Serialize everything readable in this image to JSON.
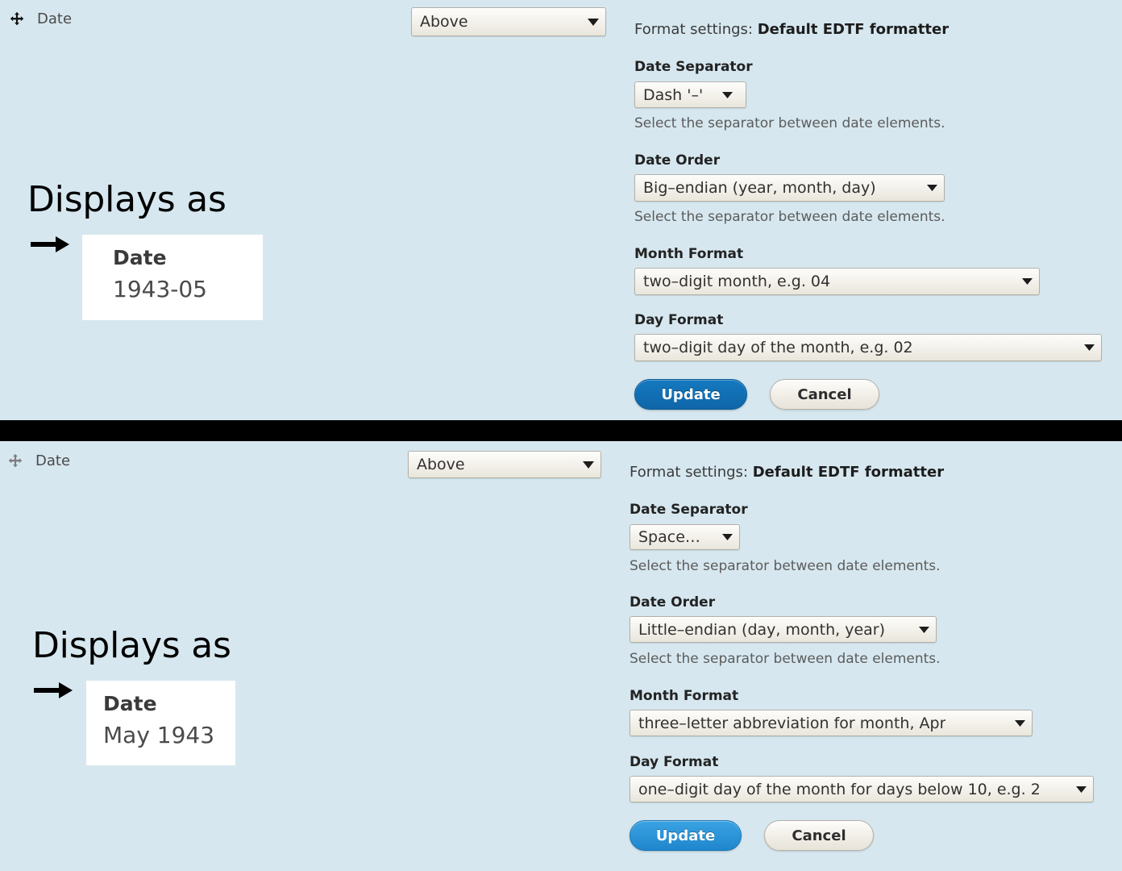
{
  "background_color": "#d6e7ef",
  "panels": [
    {
      "id": "top",
      "field": {
        "drag_handle_icon": "move-arrows-icon",
        "label": "Date",
        "label_display_select": {
          "value": "Above",
          "caret_icon": "chevron-down-icon"
        }
      },
      "preview": {
        "caption": "Displays as",
        "arrow_icon": "right-arrow-icon",
        "card_label": "Date",
        "card_value": "1943-05"
      },
      "settings": {
        "title_prefix": "Format settings:",
        "title_name": "Default EDTF formatter",
        "fields": [
          {
            "label": "Date Separator",
            "value": "Dash '–'",
            "description": "Select the separator between date elements."
          },
          {
            "label": "Date Order",
            "value": "Big–endian (year, month, day)",
            "description": "Select the separator between date elements."
          },
          {
            "label": "Month Format",
            "value": "two–digit month, e.g. 04",
            "description": ""
          },
          {
            "label": "Day Format",
            "value": "two–digit day of the month, e.g. 02",
            "description": ""
          }
        ],
        "update_label": "Update",
        "cancel_label": "Cancel",
        "update_color": "#0f66a8",
        "cancel_color": "#f2efe8"
      }
    },
    {
      "id": "bottom",
      "field": {
        "drag_handle_icon": "move-arrows-icon",
        "label": "Date",
        "label_display_select": {
          "value": "Above",
          "caret_icon": "chevron-down-icon"
        }
      },
      "preview": {
        "caption": "Displays as",
        "arrow_icon": "right-arrow-icon",
        "card_label": "Date",
        "card_value": "May 1943"
      },
      "settings": {
        "title_prefix": "Format settings:",
        "title_name": "Default EDTF formatter",
        "fields": [
          {
            "label": "Date Separator",
            "value": "Space ' '",
            "description": "Select the separator between date elements."
          },
          {
            "label": "Date Order",
            "value": "Little–endian (day, month, year)",
            "description": "Select the separator between date elements."
          },
          {
            "label": "Month Format",
            "value": "three–letter abbreviation for month, Apr",
            "description": ""
          },
          {
            "label": "Day Format",
            "value": "one–digit day of the month for days below 10, e.g. 2",
            "description": ""
          }
        ],
        "update_label": "Update",
        "cancel_label": "Cancel",
        "update_color": "#1f86cd",
        "cancel_color": "#f2efe8"
      }
    }
  ]
}
